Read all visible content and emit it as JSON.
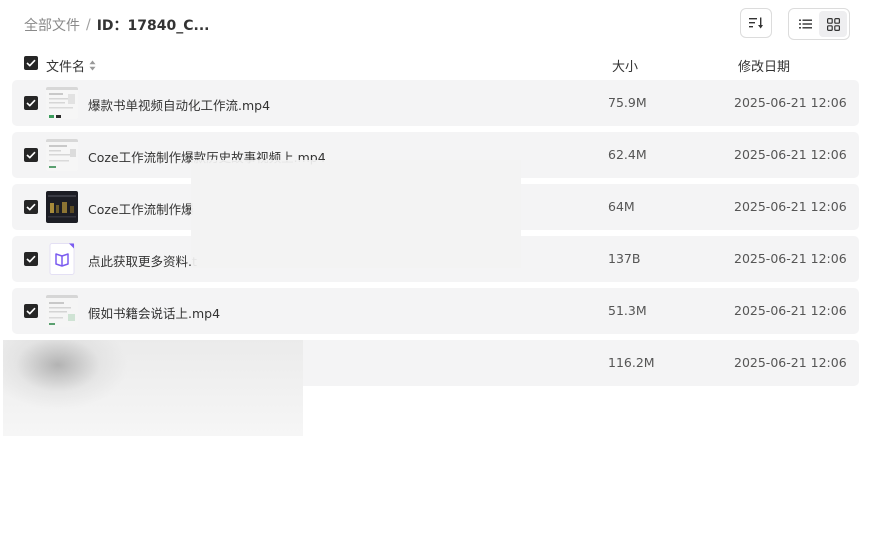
{
  "breadcrumb": {
    "root": "全部文件",
    "separator": "/",
    "current": "ID：17840_C..."
  },
  "toolbar": {
    "sort_icon": "sort-icon",
    "list_view_icon": "list-view-icon",
    "grid_view_icon": "grid-view-icon",
    "active_view": "list"
  },
  "table": {
    "columns": {
      "name": "文件名",
      "size": "大小",
      "date": "修改日期"
    },
    "rows": [
      {
        "name": "爆款书单视频自动化工作流.mp4",
        "size": "75.9M",
        "date": "2025-06-21 12:06",
        "checked": true,
        "thumb": "video-thumbnail-light"
      },
      {
        "name": "Coze工作流制作爆款历史故事视频上.mp4",
        "size": "62.4M",
        "date": "2025-06-21 12:06",
        "checked": true,
        "thumb": "video-thumbnail-light"
      },
      {
        "name": "Coze工作流制作爆",
        "size": "64M",
        "date": "2025-06-21 12:06",
        "checked": true,
        "thumb": "video-thumbnail-dark"
      },
      {
        "name": "点此获取更多资料.t",
        "size": "137B",
        "date": "2025-06-21 12:06",
        "checked": true,
        "thumb": "document-icon"
      },
      {
        "name": "假如书籍会说话上.mp4",
        "size": "51.3M",
        "date": "2025-06-21 12:06",
        "checked": true,
        "thumb": "video-thumbnail-light"
      },
      {
        "name": "",
        "size": "116.2M",
        "date": "2025-06-21 12:06",
        "checked": false,
        "thumb": ""
      }
    ]
  },
  "colors": {
    "row_bg": "#f4f4f5",
    "checkbox": "#262626",
    "doc_icon": "#7b5cf0"
  }
}
